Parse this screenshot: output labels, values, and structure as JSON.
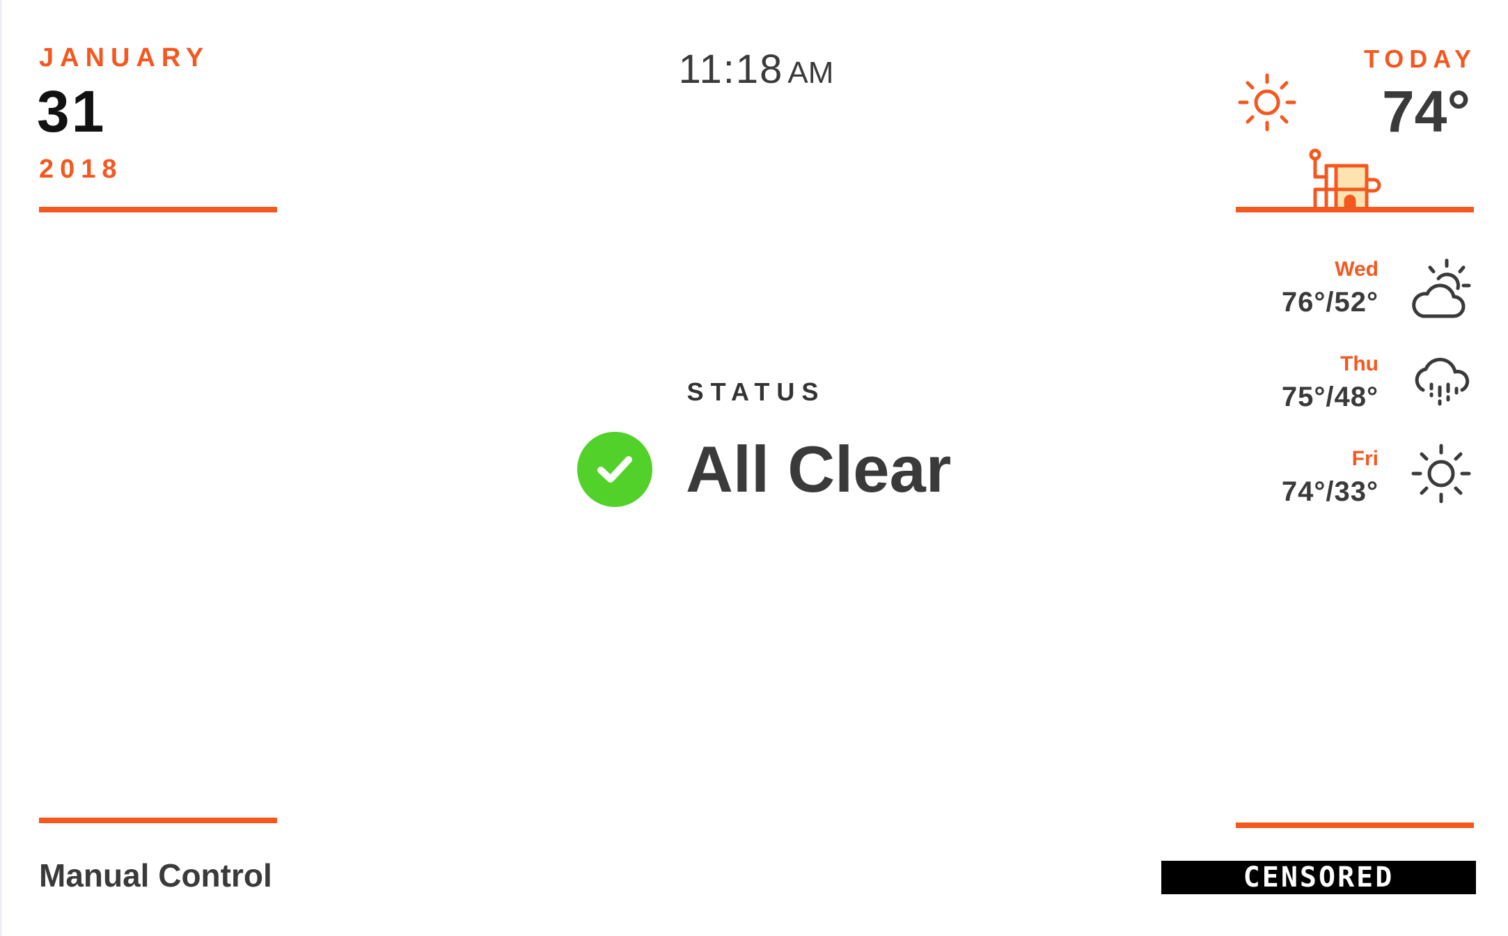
{
  "date": {
    "month": "JANUARY",
    "day": "31",
    "year": "2018"
  },
  "clock": {
    "time": "11:18",
    "ampm": "AM"
  },
  "today": {
    "label": "TODAY",
    "temp": "74°",
    "icon": "sun-icon",
    "illustration": "house-icon"
  },
  "forecast": [
    {
      "day": "Wed",
      "temps": "76°/52°",
      "icon": "partly-cloudy-icon"
    },
    {
      "day": "Thu",
      "temps": "75°/48°",
      "icon": "rain-cloud-icon"
    },
    {
      "day": "Fri",
      "temps": "74°/33°",
      "icon": "sun-icon"
    }
  ],
  "status": {
    "label": "STATUS",
    "text": "All Clear",
    "icon": "check-circle-icon"
  },
  "footer": {
    "manual_control": "Manual Control",
    "censored": "CENSORED"
  },
  "colors": {
    "accent": "#f4581f",
    "text": "#3a3a3a",
    "ok": "#52d12a",
    "house_fill": "#fde3b0"
  }
}
